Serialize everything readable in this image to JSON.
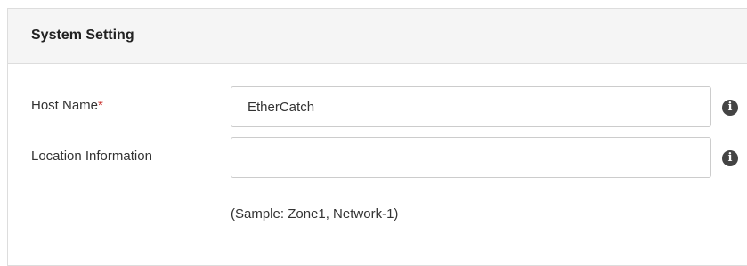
{
  "panel": {
    "title": "System Setting"
  },
  "form": {
    "host_name": {
      "label": "Host Name",
      "required_marker": "*",
      "value": "EtherCatch",
      "info_icon": "info-icon"
    },
    "location": {
      "label": "Location Information",
      "value": "",
      "info_icon": "info-icon"
    },
    "location_hint": "(Sample: Zone1, Network-1)"
  },
  "colors": {
    "header_bg": "#f5f5f5",
    "border": "#dddddd",
    "required": "#c9302c",
    "icon": "#444444"
  }
}
